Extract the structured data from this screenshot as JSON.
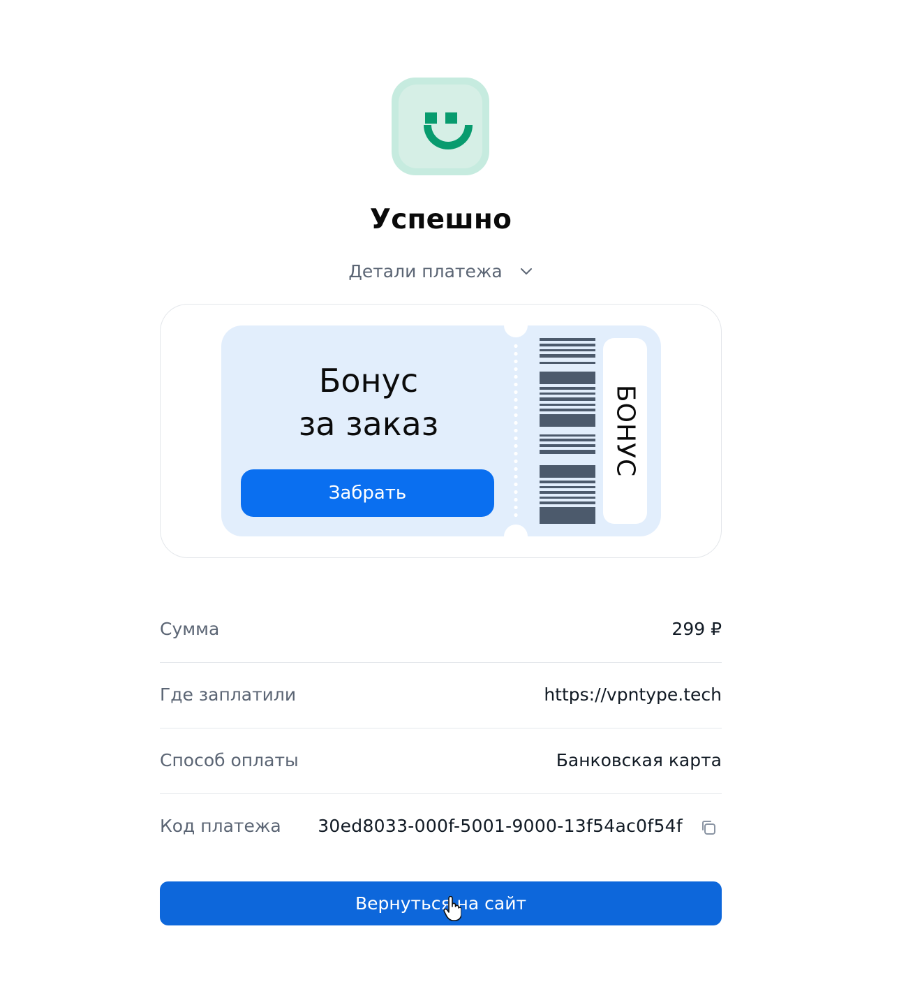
{
  "status": {
    "title": "Успешно",
    "icon": "smiley-icon",
    "accent_color": "#089b6e"
  },
  "details_toggle": {
    "label": "Детали платежа",
    "icon": "chevron-down-icon"
  },
  "bonus": {
    "title_line1": "Бонус",
    "title_line2": "за заказ",
    "claim_label": "Забрать",
    "stub_label": "БОНУС",
    "button_color": "#0a6ff0"
  },
  "payment": {
    "rows": [
      {
        "label": "Сумма",
        "value": "299 ₽"
      },
      {
        "label": "Где заплатили",
        "value": "https://vpntype.tech"
      },
      {
        "label": "Способ оплаты",
        "value": "Банковская карта"
      },
      {
        "label": "Код платежа",
        "value": "30ed8033-000f-5001-9000-13f54ac0f54f"
      }
    ],
    "copy_icon": "copy-icon"
  },
  "actions": {
    "back_label": "Вернуться на сайт",
    "button_color": "#0d67db"
  }
}
